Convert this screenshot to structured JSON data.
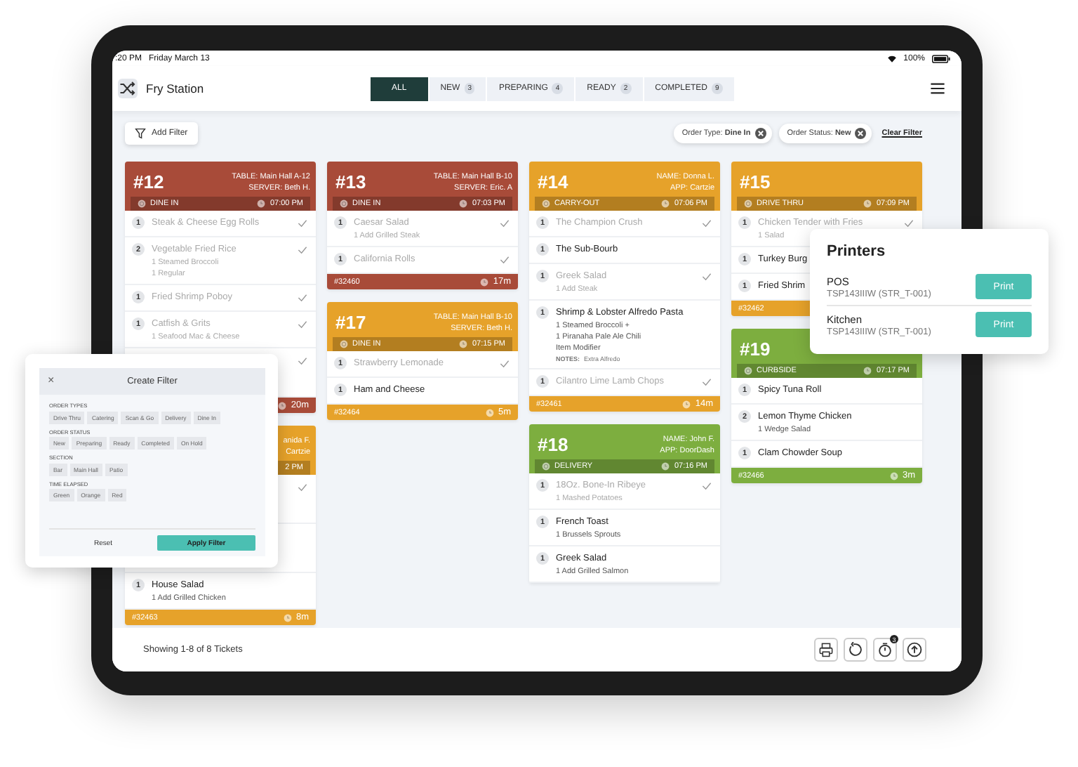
{
  "status_bar": {
    "time": ":20 PM",
    "date": "Friday March 13",
    "battery": "100%"
  },
  "header": {
    "title": "Fry Station",
    "tabs": [
      {
        "label": "ALL",
        "selected": true
      },
      {
        "label": "NEW",
        "count": "3",
        "selected": false
      },
      {
        "label": "PREPARING",
        "count": "4",
        "selected": false
      },
      {
        "label": "READY",
        "count": "2",
        "selected": false
      },
      {
        "label": "COMPLETED",
        "count": "9",
        "selected": false
      }
    ]
  },
  "filter_bar": {
    "add_filter": "Add Filter",
    "chips": [
      "Order Type: **Dine In**",
      "Order Status: **New**"
    ],
    "clear": "Clear Filter"
  },
  "columns": [
    {
      "tickets": [
        {
          "number": "#12",
          "color": "#a84b39",
          "info": [
            "TABLE: Main Hall A-12",
            "SERVER: Beth H."
          ],
          "order_type": "DINE IN",
          "time": "07:00 PM",
          "items": [
            {
              "qty": "1",
              "name": "Steak & Cheese Egg Rolls",
              "done": true
            },
            {
              "qty": "2",
              "name": "Vegetable Fried Rice",
              "modifiers": [
                "1 Steamed Broccoli",
                "1 Regular"
              ],
              "done": true
            },
            {
              "qty": "1",
              "name": "Fried Shrimp Poboy",
              "done": true
            },
            {
              "qty": "1",
              "name": "Catfish & Grits",
              "modifiers": [
                "1 Seafood Mac & Cheese"
              ],
              "done": true
            },
            {
              "done": true
            }
          ],
          "elapsed": "20m"
        },
        {
          "color": "#e6a22a",
          "info": [
            "anida F.",
            "Cartzie"
          ],
          "time": "2 PM",
          "items": [
            {
              "done": true
            },
            {
              "done": false
            },
            {
              "qty": "1",
              "name": "House Salad",
              "modifiers": [
                "1 Add Grilled Chicken"
              ],
              "done": false
            }
          ],
          "order_id": "#32463",
          "elapsed": "8m"
        }
      ]
    },
    {
      "tickets": [
        {
          "number": "#13",
          "color": "#a84b39",
          "info": [
            "TABLE: Main Hall B-10",
            "SERVER: Eric. A"
          ],
          "order_type": "DINE IN",
          "time": "07:03 PM",
          "items": [
            {
              "qty": "1",
              "name": "Caesar Salad",
              "modifiers": [
                "1 Add Grilled Steak"
              ],
              "done": true
            },
            {
              "qty": "1",
              "name": "California Rolls",
              "done": true
            }
          ],
          "order_id": "#32460",
          "elapsed": "17m"
        },
        {
          "number": "#17",
          "color": "#e6a22a",
          "info": [
            "TABLE: Main Hall B-10",
            "SERVER: Beth H."
          ],
          "order_type": "DINE IN",
          "time": "07:15 PM",
          "items": [
            {
              "qty": "1",
              "name": "Strawberry Lemonade",
              "done": true
            },
            {
              "qty": "1",
              "name": "Ham and Cheese",
              "done": false
            }
          ],
          "order_id": "#32464",
          "elapsed": "5m"
        }
      ]
    },
    {
      "tickets": [
        {
          "number": "#14",
          "color": "#e6a22a",
          "info": [
            "NAME: Donna L.",
            "APP: Cartzie"
          ],
          "order_type": "CARRY-OUT",
          "time": "07:06 PM",
          "items": [
            {
              "qty": "1",
              "name": "The Champion Crush",
              "done": true
            },
            {
              "qty": "1",
              "name": "The Sub-Bourb",
              "done": false
            },
            {
              "qty": "1",
              "name": "Greek Salad",
              "modifiers": [
                "1 Add Steak"
              ],
              "done": true
            },
            {
              "qty": "1",
              "name": "Shrimp & Lobster Alfredo Pasta",
              "modifiers": [
                "1 Steamed Broccoli +",
                "1 Piranaha Pale Ale Chili",
                "Item Modifier"
              ],
              "notes_label": "NOTES:",
              "notes": "Extra Alfredo",
              "done": false
            },
            {
              "qty": "1",
              "name": "Cilantro Lime Lamb Chops",
              "done": true
            }
          ],
          "order_id": "#32461",
          "elapsed": "14m"
        },
        {
          "number": "#18",
          "color": "#7dae3f",
          "info": [
            "NAME: John F.",
            "APP: DoorDash"
          ],
          "order_type": "DELIVERY",
          "time": "07:16 PM",
          "items": [
            {
              "qty": "1",
              "name": "18Oz. Bone-In Ribeye",
              "modifiers": [
                "1 Mashed Potatoes"
              ],
              "done": true
            },
            {
              "qty": "1",
              "name": "French Toast",
              "modifiers": [
                "1 Brussels Sprouts"
              ],
              "done": false
            },
            {
              "qty": "1",
              "name": "Greek Salad",
              "modifiers": [
                "1 Add Grilled Salmon"
              ],
              "done": false
            }
          ]
        }
      ]
    },
    {
      "tickets": [
        {
          "number": "#15",
          "color": "#e6a22a",
          "order_type": "DRIVE THRU",
          "time": "07:09 PM",
          "items": [
            {
              "qty": "1",
              "name": "Chicken Tender with Fries",
              "modifiers": [
                "1 Salad"
              ],
              "done": true
            },
            {
              "qty": "1",
              "name": "Turkey Burg",
              "done": false
            },
            {
              "qty": "1",
              "name": "Fried Shrim",
              "done": false
            }
          ],
          "order_id": "#32462"
        },
        {
          "number": "#19",
          "color": "#7dae3f",
          "order_type": "CURBSIDE",
          "time": "07:17 PM",
          "items": [
            {
              "qty": "1",
              "name": "Spicy Tuna Roll",
              "done": false
            },
            {
              "qty": "2",
              "name": "Lemon Thyme Chicken",
              "modifiers": [
                "1 Wedge Salad"
              ],
              "done": false
            },
            {
              "qty": "1",
              "name": "Clam Chowder Soup",
              "done": false
            }
          ],
          "order_id": "#32466",
          "elapsed": "3m"
        }
      ]
    }
  ],
  "footer": {
    "summary": "Showing 1-8 of 8 Tickets",
    "timer_badge": "3"
  },
  "printers": {
    "title": "Printers",
    "rows": [
      {
        "name": "POS",
        "model": "TSP143IIIW (STR_T-001)",
        "button": "Print"
      },
      {
        "name": "Kitchen",
        "model": "TSP143IIIW (STR_T-001)",
        "button": "Print"
      }
    ]
  },
  "create_filter": {
    "title": "Create Filter",
    "close": "×",
    "sections": [
      {
        "label": "ORDER TYPES",
        "options": [
          "Drive Thru",
          "Catering",
          "Scan & Go",
          "Delivery",
          "Dine In"
        ]
      },
      {
        "label": "ORDER STATUS",
        "options": [
          "New",
          "Preparing",
          "Ready",
          "Completed",
          "On Hold"
        ]
      },
      {
        "label": "SECTION",
        "options": [
          "Bar",
          "Main Hall",
          "Patio"
        ]
      },
      {
        "label": "TIME ELAPSED",
        "options": [
          "Green",
          "Orange",
          "Red"
        ]
      }
    ],
    "reset": "Reset",
    "apply": "Apply Filter"
  }
}
